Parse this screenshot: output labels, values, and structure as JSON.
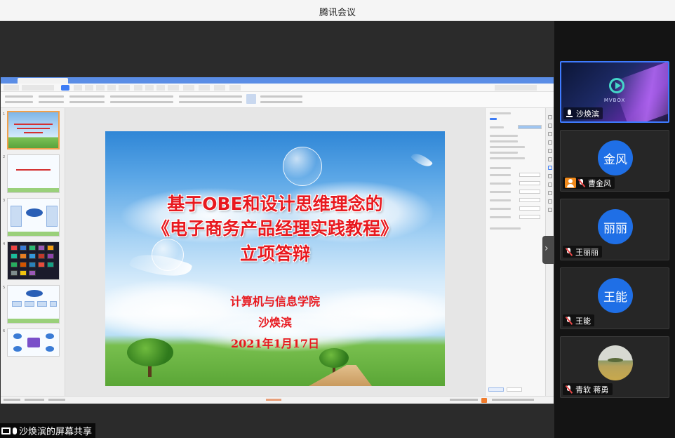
{
  "app": {
    "title": "腾讯会议"
  },
  "slide": {
    "title_line1": "基于OBE和设计思维理念的",
    "title_line2": "《电子商务产品经理实践教程》",
    "title_line3": "立项答辩",
    "college": "计算机与信息学院",
    "presenter": "沙焕滨",
    "date": "2021年1月17日"
  },
  "share": {
    "label": "沙焕滨的屏幕共享"
  },
  "participants": [
    {
      "name": "沙焕滨",
      "type": "video",
      "video_brand": "MVBOX",
      "mic": "on",
      "active": true
    },
    {
      "name": "曹金风",
      "avatar_text": "金风",
      "mic": "muted",
      "host": true
    },
    {
      "name": "王丽丽",
      "avatar_text": "丽丽",
      "mic": "muted"
    },
    {
      "name": "王能",
      "avatar_text": "王能",
      "mic": "muted"
    },
    {
      "name": "青软 蒋勇",
      "type": "photo",
      "mic": "muted"
    }
  ],
  "colors": {
    "slide_title": "#e8191f",
    "avatar_blue": "#1f6fe6",
    "active_border": "#3f7bff",
    "wps_tabbar": "#5a8de6"
  }
}
